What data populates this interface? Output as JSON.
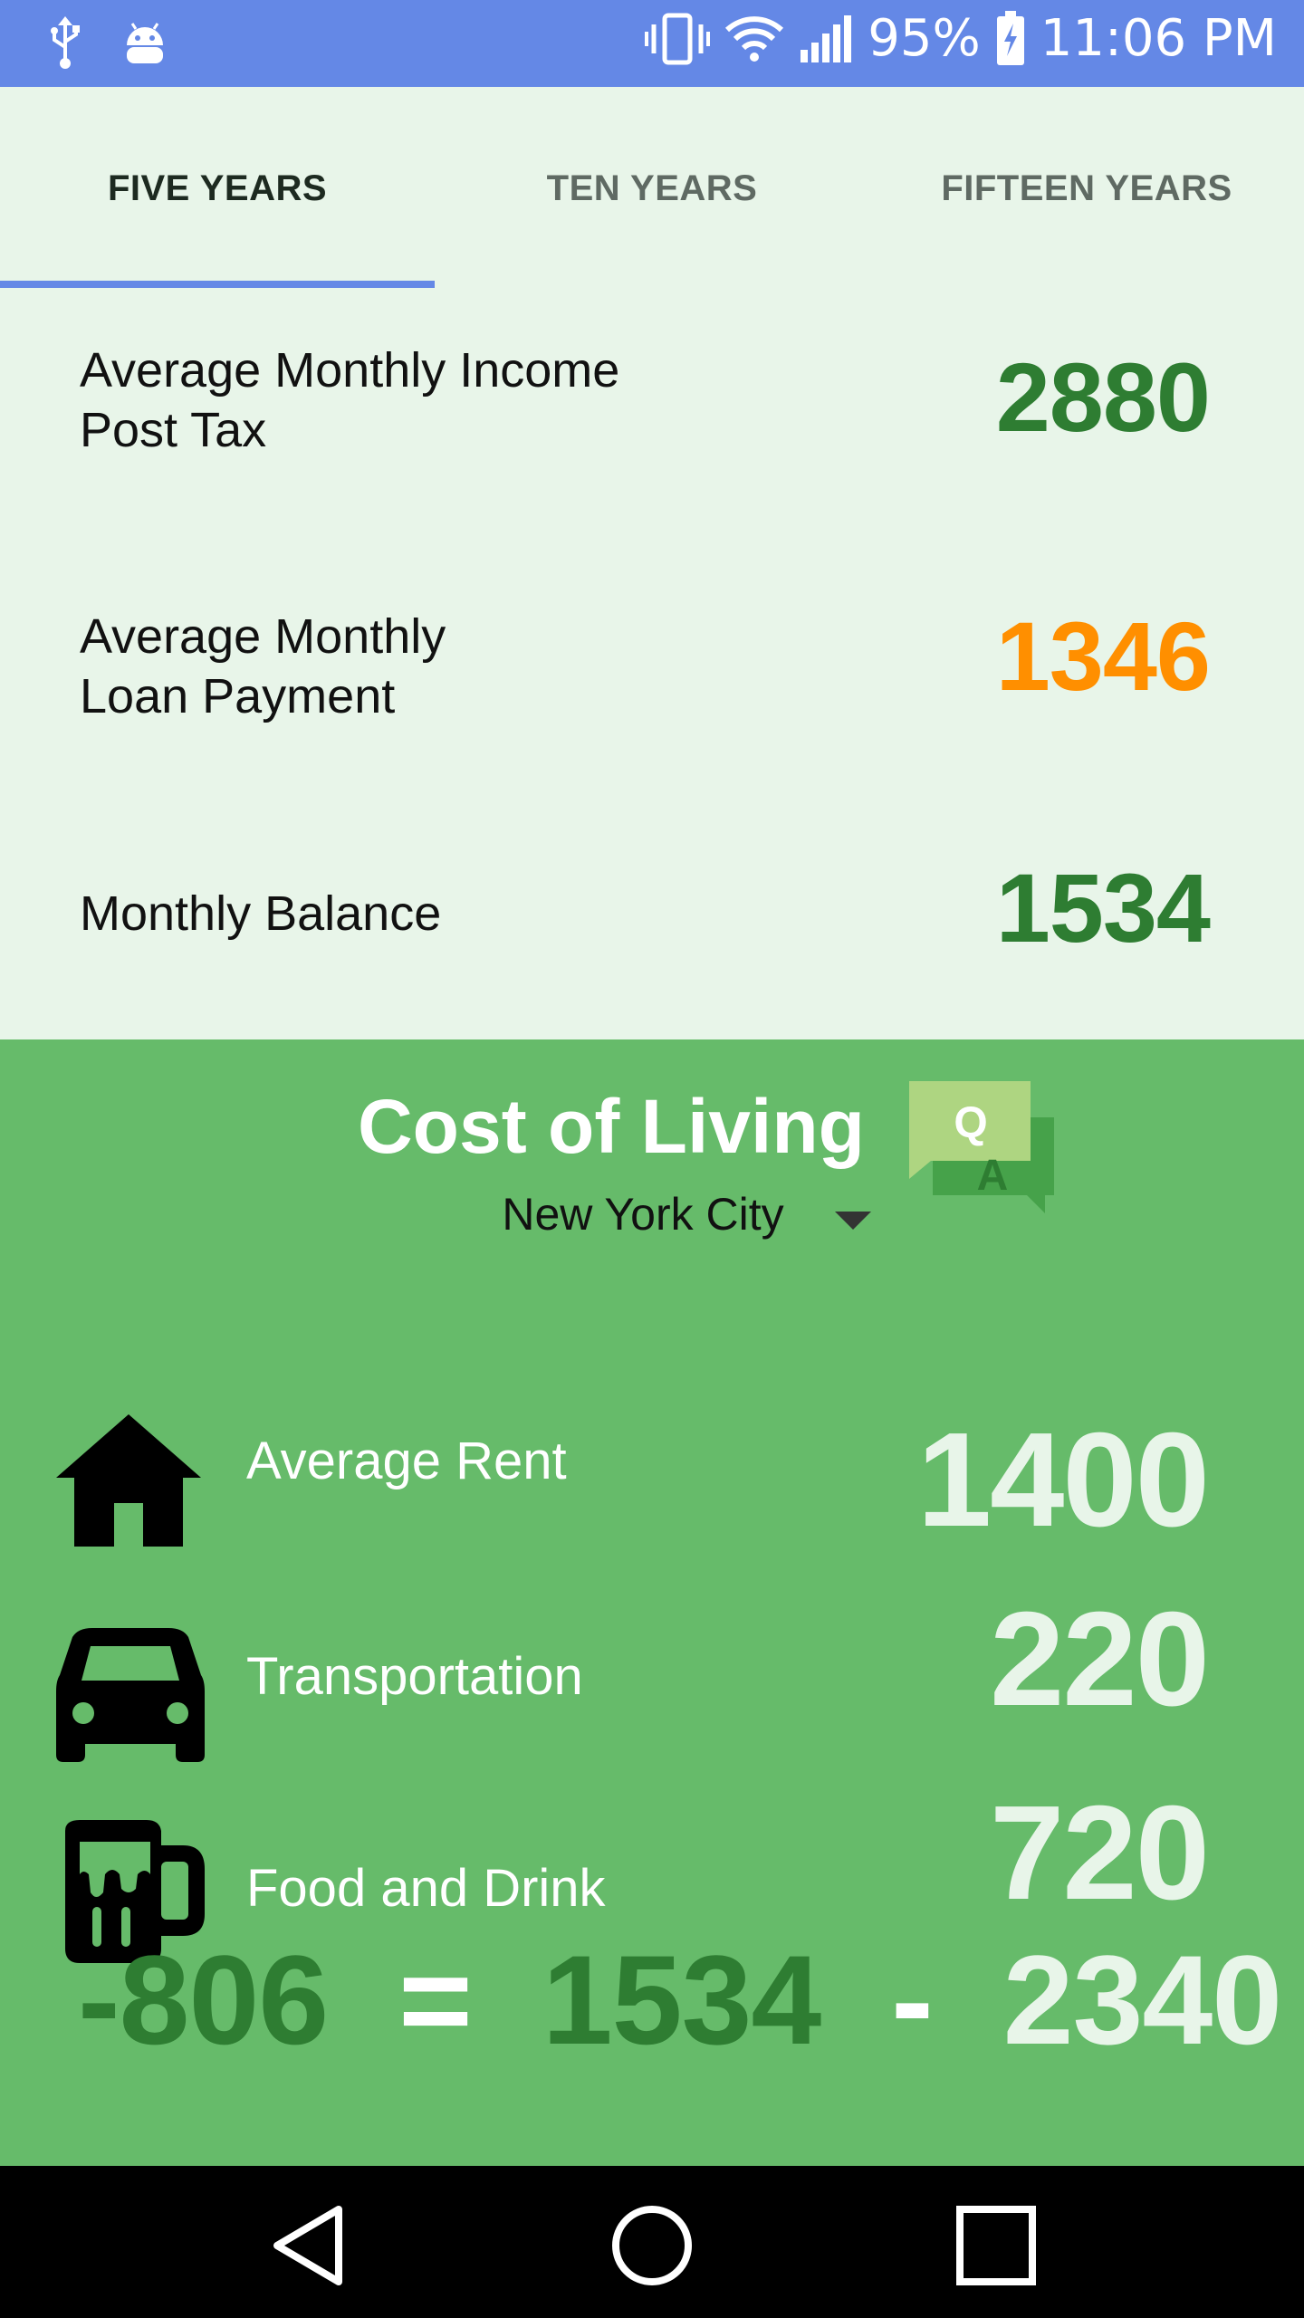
{
  "status_bar": {
    "battery_percent": "95%",
    "time": "11:06 PM",
    "icons": [
      "usb-icon",
      "android-debug-icon",
      "vibrate-icon",
      "wifi-icon",
      "signal-icon",
      "battery-charging-icon"
    ]
  },
  "tabs": [
    {
      "label": "FIVE YEARS",
      "active": true
    },
    {
      "label": "TEN YEARS",
      "active": false
    },
    {
      "label": "FIFTEEN YEARS",
      "active": false
    }
  ],
  "summary": {
    "income": {
      "label_line1": "Average Monthly Income",
      "label_line2": "Post Tax",
      "value": "2880"
    },
    "loan": {
      "label_line1": "Average Monthly",
      "label_line2": "Loan Payment",
      "value": "1346"
    },
    "balance": {
      "label": "Monthly Balance",
      "value": "1534"
    }
  },
  "cost_of_living": {
    "title": "Cost of Living",
    "qa_icon": {
      "q": "Q",
      "a": "A"
    },
    "city": "New York City",
    "items": [
      {
        "icon": "house-icon",
        "label": "Average Rent",
        "value": "1400"
      },
      {
        "icon": "car-icon",
        "label": "Transportation",
        "value": "220"
      },
      {
        "icon": "beer-mug-icon",
        "label": "Food and Drink",
        "value": "720"
      }
    ],
    "equation": {
      "result": "-806",
      "equals": "=",
      "balance": "1534",
      "minus": "-",
      "total": "2340"
    }
  },
  "colors": {
    "status_bar": "#6488e6",
    "tab_indicator": "#6488e6",
    "summary_bg": "#e8f5e9",
    "section_bg": "#66bb6a",
    "positive": "#2e7d32",
    "loan": "#ff8f00"
  },
  "nav_bar": {
    "icons": [
      "back-icon",
      "home-icon",
      "recents-icon"
    ]
  }
}
